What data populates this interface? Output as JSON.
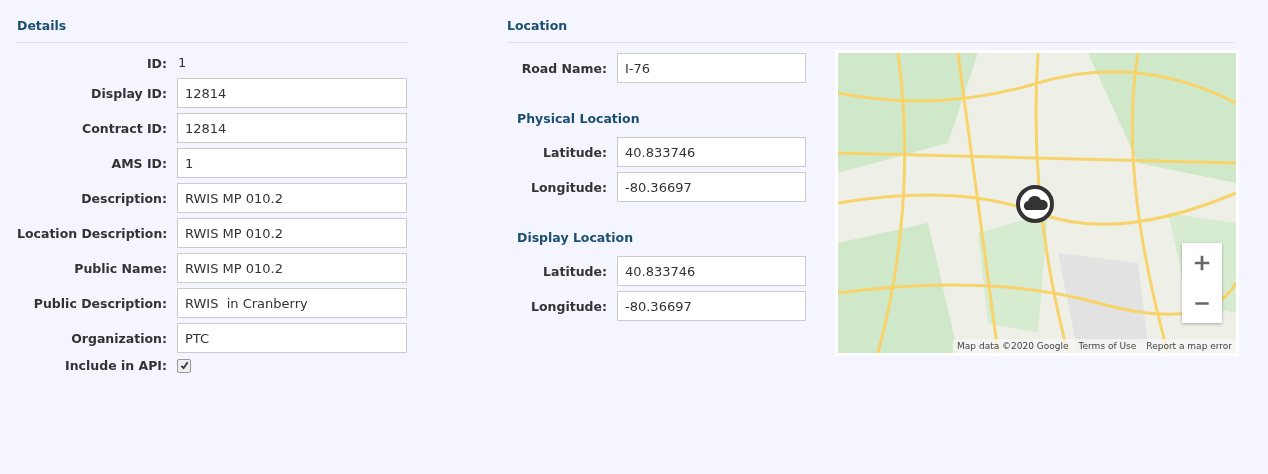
{
  "details": {
    "title": "Details",
    "fields": [
      {
        "kind": "text",
        "label": "ID:",
        "value": "1"
      },
      {
        "kind": "input",
        "label": "Display ID:",
        "value": "12814"
      },
      {
        "kind": "input",
        "label": "Contract ID:",
        "value": "12814"
      },
      {
        "kind": "input",
        "label": "AMS ID:",
        "value": "1"
      },
      {
        "kind": "input",
        "label": "Description:",
        "value": "RWIS MP 010.2"
      },
      {
        "kind": "input",
        "label": "Location Description:",
        "value": "RWIS MP 010.2"
      },
      {
        "kind": "input",
        "label": "Public Name:",
        "value": "RWIS MP 010.2"
      },
      {
        "kind": "input",
        "label": "Public Description:",
        "value": "RWIS  in Cranberry"
      },
      {
        "kind": "input",
        "label": "Organization:",
        "value": "PTC"
      },
      {
        "kind": "checkbox",
        "label": "Include in API:",
        "checked": true
      }
    ]
  },
  "location": {
    "title": "Location",
    "road_name": {
      "label": "Road Name:",
      "value": "I-76"
    },
    "groups": [
      {
        "title": "Physical Location",
        "fields": [
          {
            "label": "Latitude:",
            "value": "40.833746"
          },
          {
            "label": "Longitude:",
            "value": "-80.36697"
          }
        ]
      },
      {
        "title": "Display Location",
        "fields": [
          {
            "label": "Latitude:",
            "value": "40.833746"
          },
          {
            "label": "Longitude:",
            "value": "-80.36697"
          }
        ]
      }
    ],
    "map": {
      "kind": "picture",
      "attribution": [
        "Map data ©2020 Google",
        "Terms of Use",
        "Report a map error"
      ]
    }
  }
}
